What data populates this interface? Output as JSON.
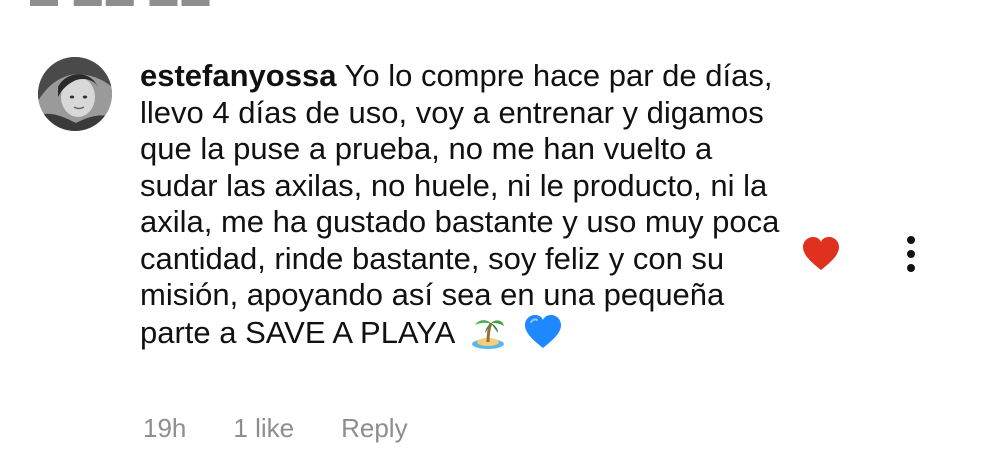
{
  "comment": {
    "username": "estefanyossa",
    "text": "Yo lo compre hace par de días, llevo 4 días de uso, voy a entrenar y digamos que la puse a prueba, no me han vuelto a sudar las axilas, no huele, ni le producto, ni la axila, me ha gustado bastante y uso muy poca cantidad, rinde bastante, soy feliz y con su misión, apoyando así sea en una pequeña parte a SAVE A PLAYA",
    "emojis": [
      "island-emoji",
      "blue-heart-emoji"
    ],
    "time": "19h",
    "likes": "1 like",
    "reply_label": "Reply",
    "liked": true
  },
  "colors": {
    "heart": "#e0301e",
    "meta_text": "#8e8e8e",
    "text": "#111111",
    "blue_heart": "#1e88ff"
  },
  "icons": {
    "like": "heart-filled-icon",
    "more": "more-vertical-icon"
  }
}
